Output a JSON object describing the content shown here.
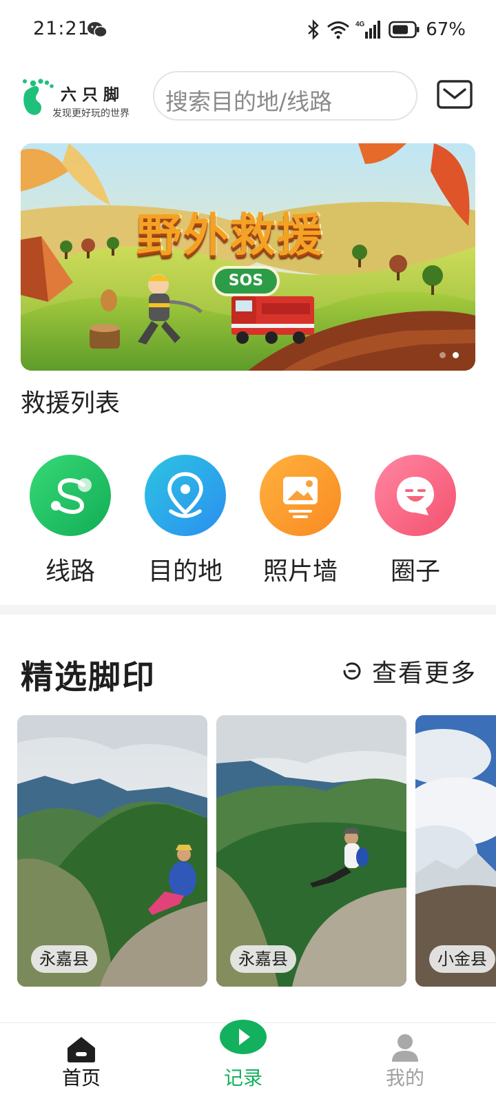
{
  "status": {
    "time": "21:21",
    "battery": "67%",
    "network": "4G"
  },
  "header": {
    "logo_name": "六只脚",
    "logo_slogan": "发现更好玩的世界",
    "search_placeholder": "搜索目的地/线路"
  },
  "banner": {
    "title": "野外救援",
    "badge": "SOS",
    "page_count": 2,
    "active_page": 2
  },
  "rescue_list_label": "救援列表",
  "categories": [
    {
      "label": "线路",
      "icon": "route-icon",
      "color": "#22c45e"
    },
    {
      "label": "目的地",
      "icon": "location-pin-icon",
      "color": "#2bb0e6"
    },
    {
      "label": "照片墙",
      "icon": "photo-icon",
      "color": "#f99a2a"
    },
    {
      "label": "圈子",
      "icon": "smile-chat-icon",
      "color": "#f8628a"
    }
  ],
  "featured": {
    "title": "精选脚印",
    "more_label": "查看更多",
    "cards": [
      {
        "location": "永嘉县"
      },
      {
        "location": "永嘉县"
      },
      {
        "location": "小金县"
      }
    ]
  },
  "nav": {
    "items": [
      {
        "label": "首页",
        "icon": "home-icon",
        "active": true
      },
      {
        "label": "记录",
        "icon": "record-play-icon",
        "active": false
      },
      {
        "label": "我的",
        "icon": "user-icon",
        "active": false
      }
    ]
  },
  "colors": {
    "brand_green": "#13b15d",
    "text_dark": "#222222",
    "text_muted": "#8a8a8a"
  }
}
